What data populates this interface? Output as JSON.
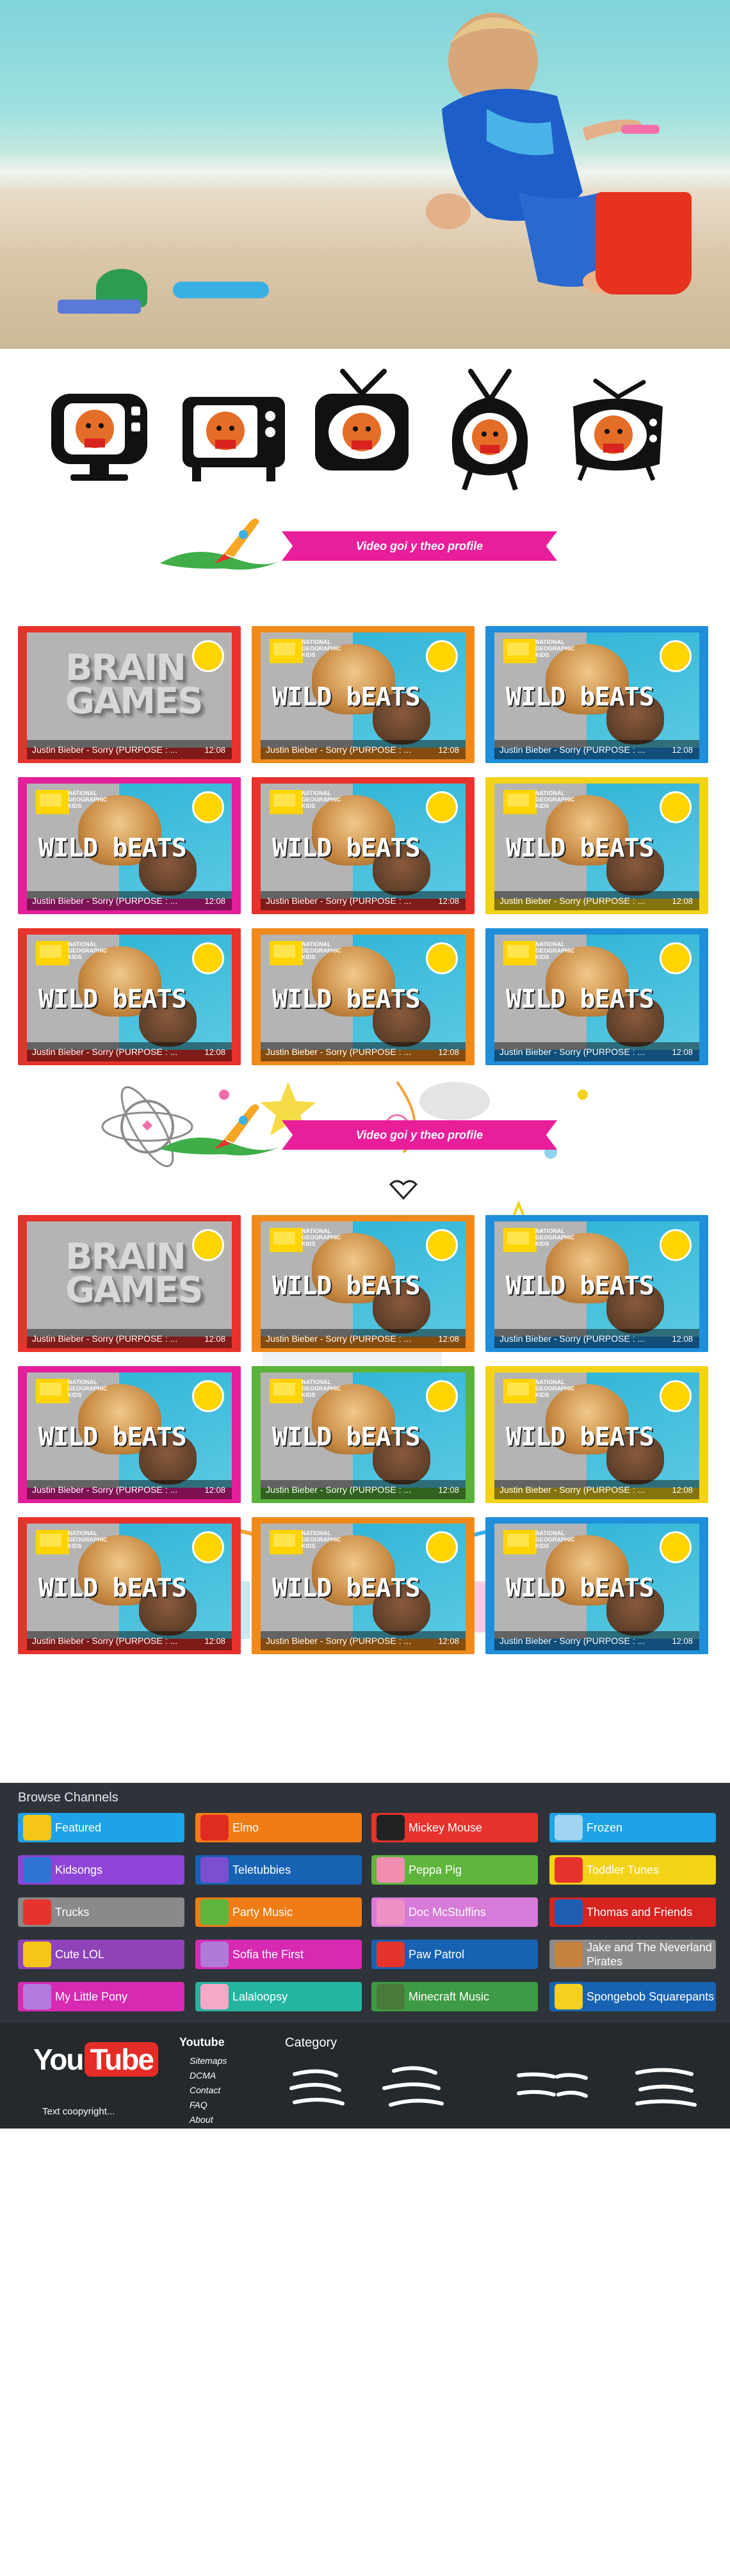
{
  "sections": [
    {
      "heading": "Video goi y theo profile"
    },
    {
      "heading": "Video goi y theo profile"
    }
  ],
  "video_cards": [
    {
      "title": "Justin Bieber - Sorry (PURPOSE : ...",
      "duration": "12:08",
      "border": "#e8322c",
      "thumb": "brain"
    },
    {
      "title": "Justin Bieber - Sorry (PURPOSE : ...",
      "duration": "12:08",
      "border": "#f08a1d",
      "thumb": "wild"
    },
    {
      "title": "Justin Bieber - Sorry (PURPOSE : ...",
      "duration": "12:08",
      "border": "#1f8fdc",
      "thumb": "wild"
    },
    {
      "title": "Justin Bieber - Sorry (PURPOSE : ...",
      "duration": "12:08",
      "border": "#e51e9a",
      "thumb": "wild"
    },
    {
      "title": "Justin Bieber - Sorry (PURPOSE : ...",
      "duration": "12:08",
      "border": "#e8322c",
      "thumb": "wild"
    },
    {
      "title": "Justin Bieber - Sorry (PURPOSE : ...",
      "duration": "12:08",
      "border": "#f2d318",
      "thumb": "wild"
    },
    {
      "title": "Justin Bieber - Sorry (PURPOSE : ...",
      "duration": "12:08",
      "border": "#e8322c",
      "thumb": "wild"
    },
    {
      "title": "Justin Bieber - Sorry (PURPOSE : ...",
      "duration": "12:08",
      "border": "#f08a1d",
      "thumb": "wild"
    },
    {
      "title": "Justin Bieber - Sorry (PURPOSE : ...",
      "duration": "12:08",
      "border": "#1f8fdc",
      "thumb": "wild"
    }
  ],
  "video_cards_2": [
    {
      "title": "Justin Bieber - Sorry (PURPOSE : ...",
      "duration": "12:08",
      "border": "#e8322c",
      "thumb": "brain"
    },
    {
      "title": "Justin Bieber - Sorry (PURPOSE : ...",
      "duration": "12:08",
      "border": "#f08a1d",
      "thumb": "wild"
    },
    {
      "title": "Justin Bieber - Sorry (PURPOSE : ...",
      "duration": "12:08",
      "border": "#1f8fdc",
      "thumb": "wild"
    },
    {
      "title": "Justin Bieber - Sorry (PURPOSE : ...",
      "duration": "12:08",
      "border": "#e51e9a",
      "thumb": "wild"
    },
    {
      "title": "Justin Bieber - Sorry (PURPOSE : ...",
      "duration": "12:08",
      "border": "#5bb33b",
      "thumb": "wild"
    },
    {
      "title": "Justin Bieber - Sorry (PURPOSE : ...",
      "duration": "12:08",
      "border": "#f2d318",
      "thumb": "wild"
    },
    {
      "title": "Justin Bieber - Sorry (PURPOSE : ...",
      "duration": "12:08",
      "border": "#e8322c",
      "thumb": "wild"
    },
    {
      "title": "Justin Bieber - Sorry (PURPOSE : ...",
      "duration": "12:08",
      "border": "#f08a1d",
      "thumb": "wild"
    },
    {
      "title": "Justin Bieber - Sorry (PURPOSE : ...",
      "duration": "12:08",
      "border": "#1f8fdc",
      "thumb": "wild"
    }
  ],
  "thumb_text": {
    "brain": "BRAIN GAMES",
    "wild": "WILD bEATS",
    "natgeo": "NATIONAL GEOGRAPHIC KIDS"
  },
  "browse": {
    "title": "Browse Channels",
    "channels": [
      {
        "label": "Featured",
        "color": "#1ea3e8",
        "icon": "star-icon",
        "icon_color": "#f5c518"
      },
      {
        "label": "Elmo",
        "color": "#f07c16",
        "icon": "elmo-icon",
        "icon_color": "#e02b20"
      },
      {
        "label": "Mickey Mouse",
        "color": "#e8322c",
        "icon": "mickey-icon",
        "icon_color": "#222222"
      },
      {
        "label": "Frozen",
        "color": "#1ea3e8",
        "icon": "frozen-icon",
        "icon_color": "#9fd4f2"
      },
      {
        "label": "Kidsongs",
        "color": "#8e44d8",
        "icon": "kidsongs-icon",
        "icon_color": "#2e73d1"
      },
      {
        "label": "Teletubbies",
        "color": "#1762b3",
        "icon": "teletubbies-icon",
        "icon_color": "#7c4fd0"
      },
      {
        "label": "Peppa Pig",
        "color": "#5fb53c",
        "icon": "peppa-icon",
        "icon_color": "#f28db2"
      },
      {
        "label": "Toddler Tunes",
        "color": "#f2d318",
        "icon": "toddler-icon",
        "icon_color": "#e8322c"
      },
      {
        "label": "Trucks",
        "color": "#8a8a8a",
        "icon": "truck-icon",
        "icon_color": "#e8322c"
      },
      {
        "label": "Party Music",
        "color": "#f07c16",
        "icon": "party-icon",
        "icon_color": "#5fb53c"
      },
      {
        "label": "Doc McStuffins",
        "color": "#d77ad9",
        "icon": "doc-icon",
        "icon_color": "#ee90c3"
      },
      {
        "label": "Thomas and Friends",
        "color": "#d8231f",
        "icon": "thomas-icon",
        "icon_color": "#1e5fb3"
      },
      {
        "label": "Cute LOL",
        "color": "#8e44b8",
        "icon": "lol-icon",
        "icon_color": "#f5c518"
      },
      {
        "label": "Sofia the First",
        "color": "#d72ab2",
        "icon": "sofia-icon",
        "icon_color": "#b07ad8"
      },
      {
        "label": "Paw Patrol",
        "color": "#1762b3",
        "icon": "paw-icon",
        "icon_color": "#e8322c"
      },
      {
        "label": "Jake and The Neverland Pirates",
        "color": "#8a8a8a",
        "icon": "jake-icon",
        "icon_color": "#c5823e"
      },
      {
        "label": "My Little Pony",
        "color": "#d72ab2",
        "icon": "pony-icon",
        "icon_color": "#b47ae0"
      },
      {
        "label": "Lalaloopsy",
        "color": "#25b4a0",
        "icon": "lalaloopsy-icon",
        "icon_color": "#f4a9c8"
      },
      {
        "label": "Minecraft Music",
        "color": "#3d9a45",
        "icon": "minecraft-icon",
        "icon_color": "#4a7a3a"
      },
      {
        "label": "Spongebob Squarepants",
        "color": "#1762b3",
        "icon": "spongebob-icon",
        "icon_color": "#f5d020"
      }
    ]
  },
  "footer": {
    "logo_you": "You",
    "logo_tube": "Tube",
    "copyright": "Text coopyright...",
    "links_title": "Youtube",
    "links": [
      "Sitemaps",
      "DCMA",
      "Contact",
      "FAQ",
      "About"
    ],
    "category_title": "Category"
  }
}
